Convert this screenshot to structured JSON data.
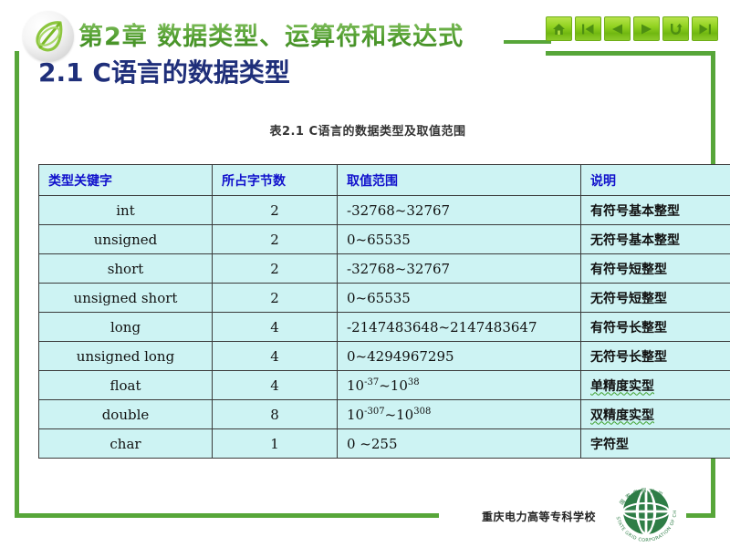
{
  "slide": {
    "chapter_title": "第2章  数据类型、运算符和表达式",
    "section_heading": "2.1  C语言的数据类型",
    "table_caption": "表2.1   C语言的数据类型及取值范围"
  },
  "nav": {
    "buttons": [
      {
        "name": "home-icon",
        "label": "首页"
      },
      {
        "name": "first-slide-icon",
        "label": "第一页"
      },
      {
        "name": "previous-slide-icon",
        "label": "上一页"
      },
      {
        "name": "next-slide-icon",
        "label": "下一页"
      },
      {
        "name": "return-icon",
        "label": "返回"
      },
      {
        "name": "last-slide-icon",
        "label": "末页"
      }
    ]
  },
  "table": {
    "headers": [
      "类型关键字",
      "所占字节数",
      "取值范围",
      "说明"
    ],
    "rows": [
      {
        "type": "int",
        "bytes": "2",
        "range": "-32768~32767",
        "range_html": "-32768~32767",
        "desc": "有符号基本整型",
        "desc_wavy": false
      },
      {
        "type": "unsigned",
        "bytes": "2",
        "range": "0~65535",
        "range_html": "0~65535",
        "desc": "无符号基本整型",
        "desc_wavy": false
      },
      {
        "type": "short",
        "bytes": "2",
        "range": "-32768~32767",
        "range_html": "-32768~32767",
        "desc": "有符号短整型",
        "desc_wavy": false
      },
      {
        "type": "unsigned short",
        "bytes": "2",
        "range": "0~65535",
        "range_html": "0~65535",
        "desc": "无符号短整型",
        "desc_wavy": false
      },
      {
        "type": "long",
        "bytes": "4",
        "range": "-2147483648~2147483647",
        "range_html": "-2147483648~2147483647",
        "desc": "有符号长整型",
        "desc_wavy": false
      },
      {
        "type": "unsigned long",
        "bytes": "4",
        "range": "0~4294967295",
        "range_html": "0~4294967295",
        "desc": "无符号长整型",
        "desc_wavy": false
      },
      {
        "type": "float",
        "bytes": "4",
        "range": "10^-37~10^38",
        "range_html": "10<sup>-37</sup>~10<sup>38</sup>",
        "desc": "单精度实型",
        "desc_wavy": true
      },
      {
        "type": "double",
        "bytes": "8",
        "range": "10^-307~10^308",
        "range_html": "10<sup>-307</sup>~10<sup>308</sup>",
        "desc": "双精度实型",
        "desc_wavy": true
      },
      {
        "type": "char",
        "bytes": "1",
        "range": "0 ~255",
        "range_html": "0 ~255",
        "desc": "字符型",
        "desc_wavy": false
      }
    ]
  },
  "footer": {
    "school": "重庆电力高等专科学校",
    "logo_name": "state-grid-corporation-of-china-logo"
  },
  "colors": {
    "frame_green": "#57a639",
    "title_green": "#5ba83a",
    "heading_navy": "#1f2f7a",
    "table_fill": "#cdf3f3",
    "table_header_text": "#1111cc",
    "nav_button_green": "#92d321",
    "squiggle_green": "#3ea02c"
  }
}
